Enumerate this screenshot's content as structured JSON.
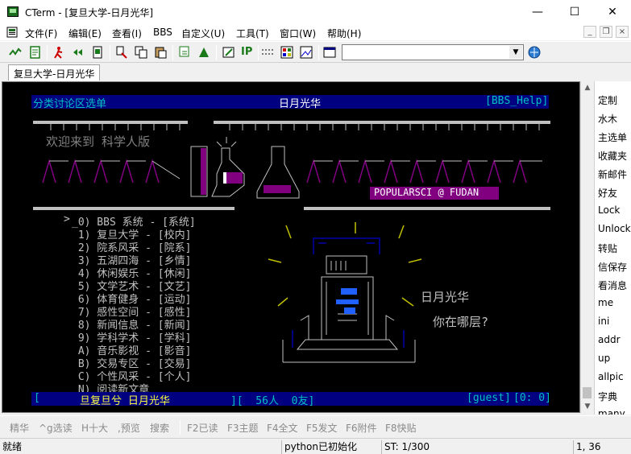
{
  "window": {
    "title": "CTerm - [复旦大学-日月光华]"
  },
  "menu": [
    "文件(F)",
    "编辑(E)",
    "查看(I)",
    "BBS",
    "自定义(U)",
    "工具(T)",
    "窗口(W)",
    "帮助(H)"
  ],
  "toolbar": {
    "ip_label": "IP",
    "address_value": ""
  },
  "tab": {
    "label": "复旦大学-日月光华"
  },
  "terminal": {
    "header_left": "分类讨论区选单",
    "header_center": "日月光华",
    "header_right": "[BBS_Help]",
    "welcome": "欢迎来到 科学人版",
    "popularsci": "POPULARSCI @ FUDAN",
    "cursor": ">",
    "menu_lines": [
      "_0) BBS 系统 - [系统]",
      " 1) 复旦大学 - [校内]",
      " 2) 院系风采 - [院系]",
      " 3) 五湖四海 - [乡情]",
      " 4) 休闲娱乐 - [休闲]",
      " 5) 文学艺术 - [文艺]",
      " 6) 体育健身 - [运动]",
      " 7) 感性空间 - [感性]",
      " 8) 新闻信息 - [新闻]",
      " 9) 学科学术 - [学科]",
      " A) 音乐影视 - [影音]",
      " B) 交易专区 - [交易]",
      " C) 个性风采 - [个人]",
      " N) 阅读新文章"
    ],
    "art_text_1": "日月光华",
    "art_text_2": "你在哪层?",
    "footer_left": "[",
    "footer_slogan": "旦复旦兮 日月光华",
    "footer_mid": "][  56人  0友]",
    "footer_user": "[guest]",
    "footer_right": "[0: 0]"
  },
  "right_panel": [
    "定制",
    "水木",
    "主选单",
    "收藏夹",
    "新邮件",
    "好友",
    "Lock",
    "Unlock",
    "转贴",
    "信保存",
    "看消息",
    "me",
    "ini",
    "addr",
    "up",
    "allpic",
    "字典",
    "many"
  ],
  "keybar": [
    "精华",
    "^g选读",
    "H十大",
    ",预览",
    "搜索",
    "F2已读",
    "F3主题",
    "F4全文",
    "F5发文",
    "F6附件",
    "F8快贴"
  ],
  "status": {
    "ready": "就绪",
    "python": "python已初始化",
    "st": "ST: 1/300",
    "pos": "1, 36"
  },
  "colors": {
    "terminal_bg": "#000000",
    "header_bar": "#000080",
    "magenta": "#800080",
    "cyan": "#00c0c0",
    "yellow": "#c0c000",
    "gray": "#c0c0c0"
  }
}
